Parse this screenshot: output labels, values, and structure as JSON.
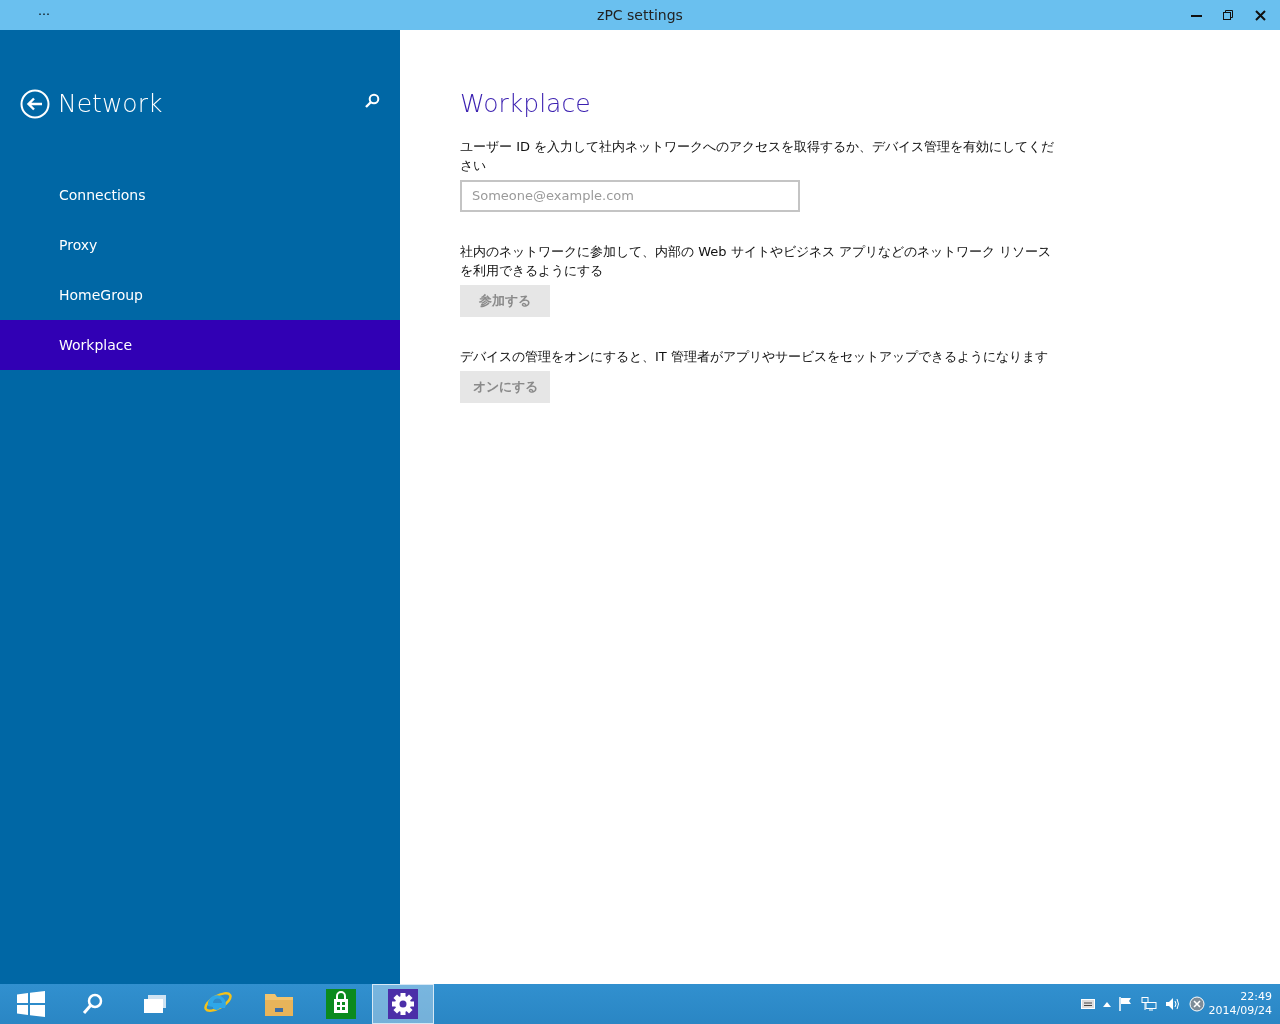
{
  "window": {
    "title": "zPC settings",
    "menu": "…"
  },
  "sidebar": {
    "title": "Network",
    "items": [
      {
        "label": "Connections",
        "selected": false
      },
      {
        "label": "Proxy",
        "selected": false
      },
      {
        "label": "HomeGroup",
        "selected": false
      },
      {
        "label": "Workplace",
        "selected": true
      }
    ]
  },
  "content": {
    "title": "Workplace",
    "sections": [
      {
        "kind": "field",
        "text": "ユーザー ID を入力して社内ネットワークへのアクセスを取得するか、デバイス管理を有効にしてください",
        "placeholder": "Someone@example.com"
      },
      {
        "kind": "button",
        "text": "社内のネットワークに参加して、内部の Web サイトやビジネス アプリなどのネットワーク リソースを利用できるようにする",
        "button": "参加する",
        "disabled": true
      },
      {
        "kind": "button",
        "text": "デバイスの管理をオンにすると、IT 管理者がアプリやサービスをセットアップできるようになります",
        "button": "オンにする",
        "disabled": true
      }
    ]
  },
  "taskbar": {
    "apps": [
      {
        "kind": "start",
        "selected": false
      },
      {
        "kind": "search",
        "selected": false
      },
      {
        "kind": "taskview",
        "selected": false
      },
      {
        "kind": "browser",
        "selected": false
      },
      {
        "kind": "folder",
        "selected": false
      },
      {
        "kind": "store",
        "selected": false
      },
      {
        "kind": "settings",
        "selected": true
      }
    ],
    "tray": [
      {
        "kind": "keyboard"
      },
      {
        "kind": "chevron"
      },
      {
        "kind": "flag"
      },
      {
        "kind": "network"
      },
      {
        "kind": "volume"
      },
      {
        "kind": "blocked"
      }
    ],
    "time": "22:49",
    "date": "2014/09/24"
  }
}
